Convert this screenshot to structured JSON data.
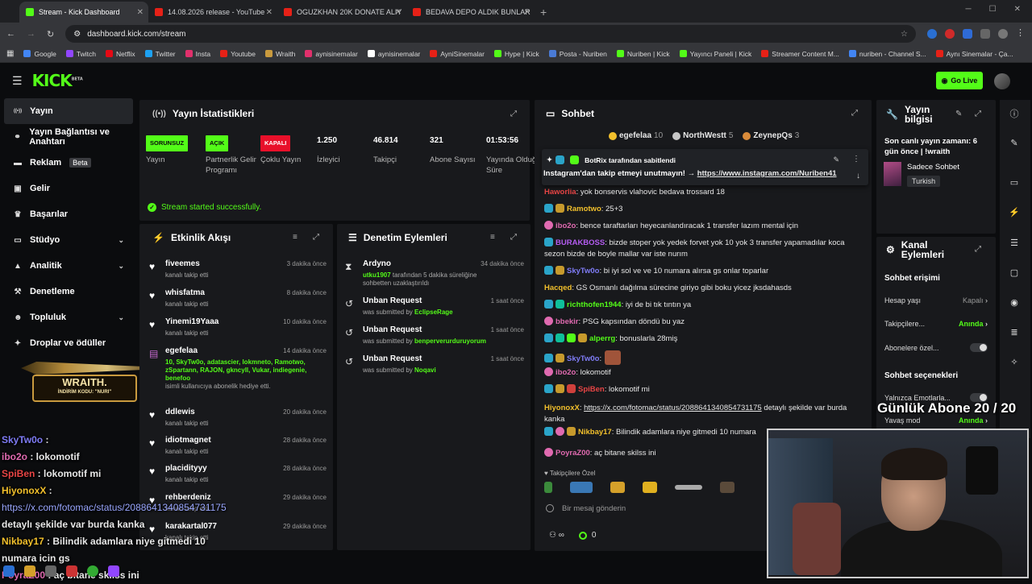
{
  "browser": {
    "tabs": [
      {
        "label": "Stream - Kick Dashboard",
        "active": true,
        "color": "#53fc18"
      },
      {
        "label": "14.08.2026 release - YouTube",
        "active": false,
        "color": "#e62117"
      },
      {
        "label": "OGUZKHAN 20K DONATE ALIY",
        "active": false,
        "color": "#e62117"
      },
      {
        "label": "BEDAVA DEPO ALDIK BUNLAR",
        "active": false,
        "color": "#e62117"
      }
    ],
    "url": "dashboard.kick.com/stream",
    "bookmarks": [
      "Google",
      "Twitch",
      "Netflix",
      "Twitter",
      "Insta",
      "Youtube",
      "Wraith",
      "aynisinemalar",
      "aynisinemalar",
      "AyniSinemalar",
      "Hype | Kick",
      "Posta - Nuriben",
      "Nuriben | Kick",
      "Yayıncı Paneli | Kick",
      "Streamer Content M...",
      "nuriben - Channel S...",
      "Aynı Sinemalar - Ça..."
    ]
  },
  "header": {
    "brand": "KICK",
    "brand_sup": "BETA",
    "go_live": "Go Live"
  },
  "sidebar": {
    "items": [
      {
        "label": "Yayın",
        "icon": "broadcast-icon",
        "chev": false
      },
      {
        "label": "Yayın Bağlantısı ve Anahtarı",
        "icon": "link-icon",
        "chev": false
      },
      {
        "label": "Reklam",
        "icon": "ad-icon",
        "chev": false,
        "badge": "Beta"
      },
      {
        "label": "Gelir",
        "icon": "wallet-icon",
        "chev": false
      },
      {
        "label": "Başarılar",
        "icon": "trophy-icon",
        "chev": false
      },
      {
        "label": "Stüdyo",
        "icon": "studio-icon",
        "chev": true
      },
      {
        "label": "Analitik",
        "icon": "chart-icon",
        "chev": true
      },
      {
        "label": "Denetleme",
        "icon": "hammer-icon",
        "chev": false
      },
      {
        "label": "Topluluk",
        "icon": "community-icon",
        "chev": true
      },
      {
        "label": "Droplar ve ödüller",
        "icon": "gift-icon",
        "chev": false
      }
    ]
  },
  "wraith_banner": {
    "brand": "WRAITH.",
    "code_label": "İNDİRİM KODU:",
    "code": "NURI"
  },
  "stats": {
    "title": "Yayın İstatistikleri",
    "columns": [
      {
        "value": "SORUNSUZ",
        "label": "Yayın",
        "pill": "g"
      },
      {
        "value": "AÇIK",
        "label": "Partnerlik Gelir Programı",
        "pill": "g"
      },
      {
        "value": "KAPALI",
        "label": "Çoklu Yayın",
        "pill": "r"
      },
      {
        "value": "1.250",
        "label": "İzleyici"
      },
      {
        "value": "46.814",
        "label": "Takipçi"
      },
      {
        "value": "321",
        "label": "Abone Sayısı"
      },
      {
        "value": "01:53:56",
        "label": "Yayında Olduğu Süre"
      }
    ],
    "success": "Stream started successfully."
  },
  "activity": {
    "title": "Etkinlik Akışı",
    "items": [
      {
        "name": "fiveemes",
        "sub": "kanalı takip etti",
        "time": "3 dakika önce",
        "icon": "heart-icon"
      },
      {
        "name": "whisfatma",
        "sub": "kanalı takip etti",
        "time": "8 dakika önce",
        "icon": "heart-icon"
      },
      {
        "name": "Yinemi19Yaaa",
        "sub": "kanalı takip etti",
        "time": "10 dakika önce",
        "icon": "heart-icon"
      },
      {
        "name": "egefelaa",
        "gift": "10, SkyTw0o, adatascier, lokmneto, Ramotwo, zSpartann, RAJON, gkncyll, Vukar, indiegenie, benefoo",
        "sub": "isimli kullanıcıya abonelik hediye etti.",
        "time": "14 dakika önce",
        "icon": "gift-icon"
      },
      {
        "name": "ddlewis",
        "sub": "kanalı takip etti",
        "time": "20 dakika önce",
        "icon": "heart-icon"
      },
      {
        "name": "idiotmagnet",
        "sub": "kanalı takip etti",
        "time": "28 dakika önce",
        "icon": "heart-icon"
      },
      {
        "name": "placidityyy",
        "sub": "kanalı takip etti",
        "time": "28 dakika önce",
        "icon": "heart-icon"
      },
      {
        "name": "rehberdeniz",
        "sub": "kanalı takip etti",
        "time": "29 dakika önce",
        "icon": "heart-icon"
      },
      {
        "name": "karakartal077",
        "sub": "kanalı takip etti",
        "time": "29 dakika önce",
        "icon": "heart-icon"
      }
    ]
  },
  "modlog": {
    "title": "Denetim Eylemleri",
    "items": [
      {
        "name": "Ardyno",
        "target": "utku1907",
        "sub": " tarafından 5 dakika süreliğine sohbetten uzaklaştırıldı",
        "time": "34 dakika önce",
        "icon": "hourglass-icon"
      },
      {
        "name": "Unban Request",
        "pre": "was submitted by ",
        "target": "EclipseRage",
        "time": "1 saat önce",
        "icon": "history-icon"
      },
      {
        "name": "Unban Request",
        "pre": "was submitted by ",
        "target": "benperverurduruyorum",
        "time": "1 saat önce",
        "icon": "history-icon"
      },
      {
        "name": "Unban Request",
        "pre": "was submitted by ",
        "target": "Noqavi",
        "time": "1 saat önce",
        "icon": "history-icon"
      }
    ]
  },
  "chat": {
    "title": "Sohbet",
    "leaders": [
      {
        "name": "egefelaa",
        "count": "10",
        "color": "#f2c02c"
      },
      {
        "name": "NorthWestt",
        "count": "5",
        "color": "#c7c7c7"
      },
      {
        "name": "ZeynepQs",
        "count": "3",
        "color": "#d98b3a"
      }
    ],
    "pinned_by": "BotRix tarafından sabitlendi",
    "pinned_text": "Instagram'dan takip etmeyi unutmayın! → ",
    "pinned_link": "https://www.instagram.com/Nuriben41",
    "messages": [
      {
        "user": "Haworlia",
        "color": "#e84545",
        "text": ": yok bonservis vlahovic bedava trossard 18",
        "badges": []
      },
      {
        "user": "Ramotwo",
        "color": "#f2c02c",
        "text": ": 25+3",
        "badges": [
          "b-sub",
          "b-gold"
        ]
      },
      {
        "user": "ibo2o",
        "color": "#e06ab0",
        "text": ": bence taraftarları heyecanlandıracak 1 transfer lazım mental için",
        "badges": [
          "b-pink"
        ]
      },
      {
        "user": "BURAKBOSS",
        "color": "#b55cf2",
        "text": ": bizde stoper yok yedek forvet yok 10 yok 3 transfer yapamadılar koca sezon bizde de boyle mallar var iste nurım",
        "badges": [
          "b-sub"
        ]
      },
      {
        "user": "SkyTw0o",
        "color": "#7f7cf5",
        "text": ": bi iyi sol ve ve 10 numara alırsa gs onlar toparlar",
        "badges": [
          "b-sub",
          "b-gold"
        ]
      },
      {
        "user": "Hacqed",
        "color": "#f2c02c",
        "text": ": GS Osmanlı dağılma sürecine giriyo gibi boku yicez jksdahasds",
        "badges": []
      },
      {
        "user": "richthofen1944",
        "color": "#53fc18",
        "text": ": iyi de bi tık tıntın ya",
        "badges": [
          "b-sub",
          "b-teal"
        ]
      },
      {
        "user": "bbekir",
        "color": "#e06ab0",
        "text": ": PSG kapsından döndü bu yaz",
        "badges": [
          "b-pink"
        ]
      },
      {
        "user": "alperrg",
        "color": "#53fc18",
        "text": ": bonuslarla 28miş",
        "badges": [
          "b-sub",
          "b-teal",
          "b-green",
          "b-gold"
        ]
      },
      {
        "user": "SkyTw0o",
        "color": "#7f7cf5",
        "text": ":",
        "badges": [
          "b-sub",
          "b-gold"
        ]
      },
      {
        "user": "ibo2o",
        "color": "#e06ab0",
        "text": ": lokomotif",
        "badges": [
          "b-pink"
        ]
      },
      {
        "user": "SpiBen",
        "color": "#e84545",
        "text": ": lokomotif mi",
        "badges": [
          "b-sub",
          "b-gold",
          "b-red"
        ]
      },
      {
        "user": "HiyonoxX",
        "color": "#f2c02c",
        "text": ": ",
        "link": "https://x.com/fotomac/status/2088641340854731175",
        "tail": " detaylı şekilde var burda kanka",
        "badges": []
      },
      {
        "user": "Nikbay17",
        "color": "#f2c02c",
        "text": ": Bilindik adamlara niye gitmedi 10 numara",
        "badges": [
          "b-sub",
          "b-pink",
          "b-gold"
        ]
      },
      {
        "user": "PoyraZ00",
        "color": "#e06ab0",
        "text": ": aç bitane skilss ini",
        "badges": [
          "b-pink"
        ]
      }
    ],
    "followers_label": "Takipçilere Özel",
    "input_placeholder": "Bir mesaj gönderin",
    "foot_count": "0"
  },
  "info": {
    "title": "Yayın bilgisi",
    "last": "Son canlı yayın zamanı: 6 gün önce | !wraith",
    "category": "Sadece Sohbet",
    "language": "Turkish"
  },
  "channel": {
    "title": "Kanal Eylemleri",
    "chat_access": "Sohbet erişimi",
    "rows1": [
      {
        "label": "Hesap yaşı",
        "value": "Kapalı",
        "kind": "gr"
      },
      {
        "label": "Takipçilere...",
        "value": "Anında",
        "kind": "gv"
      },
      {
        "label": "Abonelere özel...",
        "value": "",
        "kind": "toggle"
      }
    ],
    "chat_options": "Sohbet seçenekleri",
    "rows2": [
      {
        "label": "Yalnızca Emotlarla...",
        "value": "",
        "kind": "toggle"
      },
      {
        "label": "Yavaş mod",
        "value": "Anında",
        "kind": "gv"
      }
    ]
  },
  "overlay": {
    "gunluk": "Günlük Abone 20 / 20",
    "lines": [
      {
        "user": "SkyTw0o",
        "color": "#7f7cf5",
        "text": " : "
      },
      {
        "user": "ibo2o",
        "color": "#e06ab0",
        "text": " : lokomotif"
      },
      {
        "user": "SpiBen",
        "color": "#e84545",
        "text": " : lokomotif mi"
      },
      {
        "user": "HiyonoxX",
        "color": "#f2c02c",
        "text": " :"
      },
      {
        "user": "",
        "color": "#fff",
        "text": "https://x.com/fotomac/status/2088641340854731175",
        "link": true
      },
      {
        "user": "",
        "color": "#fff",
        "text": "detaylı şekilde var burda kanka"
      },
      {
        "user": "Nikbay17",
        "color": "#f2c02c",
        "text": " : Bilindik adamlara niye gitmedi 10"
      },
      {
        "user": "",
        "color": "#fff",
        "text": "numara icin gs"
      },
      {
        "user": "PoyraZ00",
        "color": "#e06ab0",
        "text": " : aç bitane skilss ini"
      }
    ]
  }
}
